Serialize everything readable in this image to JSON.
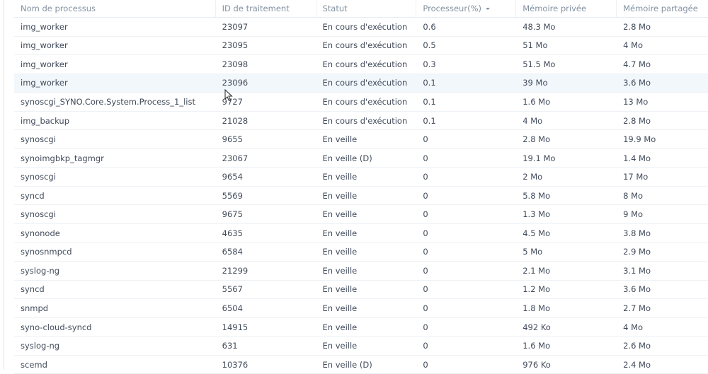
{
  "columns": [
    "Nom de processus",
    "ID de traitement",
    "Statut",
    "Processeur(%)",
    "Mémoire privée",
    "Mémoire partagée"
  ],
  "sorted_column": "Processeur(%)",
  "rows": [
    [
      "img_worker",
      "23097",
      "En cours d'exécution",
      "0.6",
      "48.3 Mo",
      "2.8 Mo"
    ],
    [
      "img_worker",
      "23095",
      "En cours d'exécution",
      "0.5",
      "51 Mo",
      "4 Mo"
    ],
    [
      "img_worker",
      "23098",
      "En cours d'exécution",
      "0.3",
      "51.5 Mo",
      "4.7 Mo"
    ],
    [
      "img_worker",
      "23096",
      "En cours d'exécution",
      "0.1",
      "39 Mo",
      "3.6 Mo"
    ],
    [
      "synoscgi_SYNO.Core.System.Process_1_list",
      "9727",
      "En cours d'exécution",
      "0.1",
      "1.6 Mo",
      "13 Mo"
    ],
    [
      "img_backup",
      "21028",
      "En cours d'exécution",
      "0.1",
      "4 Mo",
      "2.8 Mo"
    ],
    [
      "synoscgi",
      "9655",
      "En veille",
      "0",
      "2.8 Mo",
      "19.9 Mo"
    ],
    [
      "synoimgbkp_tagmgr",
      "23067",
      "En veille (D)",
      "0",
      "19.1 Mo",
      "1.4 Mo"
    ],
    [
      "synoscgi",
      "9654",
      "En veille",
      "0",
      "2 Mo",
      "17 Mo"
    ],
    [
      "syncd",
      "5569",
      "En veille",
      "0",
      "5.8 Mo",
      "8 Mo"
    ],
    [
      "synoscgi",
      "9675",
      "En veille",
      "0",
      "1.3 Mo",
      "9 Mo"
    ],
    [
      "synonode",
      "4635",
      "En veille",
      "0",
      "4.5 Mo",
      "3.8 Mo"
    ],
    [
      "synosnmpcd",
      "6584",
      "En veille",
      "0",
      "5 Mo",
      "2.9 Mo"
    ],
    [
      "syslog-ng",
      "21299",
      "En veille",
      "0",
      "2.1 Mo",
      "3.1 Mo"
    ],
    [
      "syncd",
      "5567",
      "En veille",
      "0",
      "1.2 Mo",
      "3.6 Mo"
    ],
    [
      "snmpd",
      "6504",
      "En veille",
      "0",
      "1.8 Mo",
      "2.7 Mo"
    ],
    [
      "syno-cloud-syncd",
      "14915",
      "En veille",
      "0",
      "492 Ko",
      "4 Mo"
    ],
    [
      "syslog-ng",
      "631",
      "En veille",
      "0",
      "1.6 Mo",
      "2.6 Mo"
    ],
    [
      "scemd",
      "10376",
      "En veille (D)",
      "0",
      "976 Ko",
      "2.4 Mo"
    ]
  ],
  "hover_row": 3
}
